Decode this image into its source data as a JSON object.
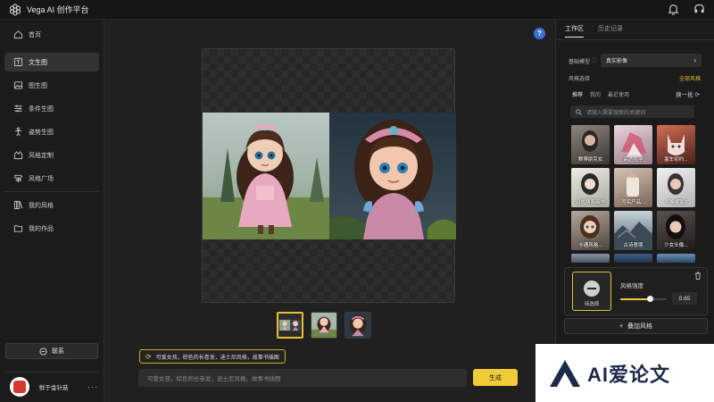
{
  "app": {
    "title": "Vega AI 创作平台"
  },
  "sidebar": {
    "items": [
      {
        "label": "首页",
        "icon": "home-icon"
      },
      {
        "label": "文生图",
        "icon": "text-image-icon"
      },
      {
        "label": "图生图",
        "icon": "image-icon"
      },
      {
        "label": "条件生图",
        "icon": "sliders-icon"
      },
      {
        "label": "姿势生图",
        "icon": "pose-icon"
      },
      {
        "label": "风格定制",
        "icon": "style-custom-icon"
      },
      {
        "label": "风格广场",
        "icon": "signpost-icon"
      },
      {
        "label": "我的风格",
        "icon": "books-icon"
      },
      {
        "label": "我的作品",
        "icon": "folder-icon"
      }
    ],
    "active_index": 1,
    "contact_label": "联系",
    "user": {
      "name": "鲜于金针菇",
      "more": "···"
    }
  },
  "main": {
    "help": "?",
    "prompt_chip": "可爱女孩，棕色的长卷发，迪士尼风格，故事书插图",
    "prompt_placeholder": "可爱女孩，棕色的长卷发，迪士尼风格，故事书插图",
    "generate_label": "生成",
    "thumbnail_selected_index": 0
  },
  "right_panel": {
    "tabs": [
      "工作区",
      "历史记录"
    ],
    "active_tab": 0,
    "base_model_label": "基础模型",
    "base_model_value": "真实影像",
    "style_select_label": "风格选择",
    "all_styles_label": "全部风格",
    "style_tabs": [
      "推荐",
      "我的",
      "最近使用"
    ],
    "active_style_tab": 0,
    "refresh_label": "换一批",
    "search_placeholder": "请输入需要搜索的关键词",
    "style_cards": [
      {
        "label": "赛博朋克女",
        "bg": "#6b6560"
      },
      {
        "label": "高达机甲",
        "bg": "#b7a9b0"
      },
      {
        "label": "塞车初约...",
        "bg": "#a84a3a"
      },
      {
        "label": "日式萌系画作",
        "bg": "#cfcfc6"
      },
      {
        "label": "写实产品...",
        "bg": "#b9a79a"
      },
      {
        "label": "人像摄影2",
        "bg": "#d9d9da"
      },
      {
        "label": "卡通风格...",
        "bg": "#8a7d73"
      },
      {
        "label": "古诗意境",
        "bg": "#687a88"
      },
      {
        "label": "少女头像...",
        "bg": "#3e3936"
      },
      {
        "label": "",
        "bg": "#8a92a0"
      },
      {
        "label": "",
        "bg": "#2f4868"
      },
      {
        "label": "",
        "bg": "#4c6f90"
      }
    ],
    "slot_label": "待选择",
    "strength_label": "风格强度",
    "strength_value": "0.65",
    "strength_fraction": 0.65,
    "add_style_label": "叠加风格"
  },
  "watermark": {
    "text": "AI爱论文"
  },
  "colors": {
    "accent": "#f2cc36",
    "active_nav": "#333333",
    "help": "#3c6fd6"
  }
}
